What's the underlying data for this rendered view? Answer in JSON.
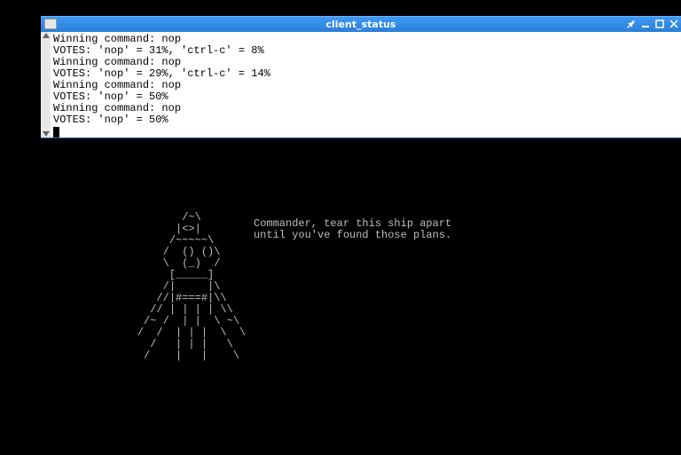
{
  "window": {
    "title": "client_status"
  },
  "terminal": {
    "lines": [
      "Winning command: nop",
      "VOTES: 'nop' = 31%, 'ctrl-c' = 8%",
      "Winning command: nop",
      "VOTES: 'nop' = 29%, 'ctrl-c' = 14%",
      "Winning command: nop",
      "VOTES: 'nop' = 50%",
      "Winning command: nop",
      "VOTES: 'nop' = 50%"
    ]
  },
  "ascii": {
    "art": "       /~\\\n      |<>|\n     /~~~~~\\\n    /  () ()\\\n    \\  (_)  /\n     [_____]\n    /|     |\\\n   //|#===#|\\\\\n  // | | | | \\\\\n /~ /  | |  \\ ~\\\n/  /  | | |  \\  \\\n  /   | | |   \\\n /    |   |    \\",
    "dialogue_line1": "Commander, tear this ship apart",
    "dialogue_line2": "until you've found those plans."
  },
  "icons": {
    "app": "app-icon",
    "pin": "pin-icon",
    "minimize": "minimize-icon",
    "maximize": "maximize-icon",
    "close": "close-icon"
  }
}
